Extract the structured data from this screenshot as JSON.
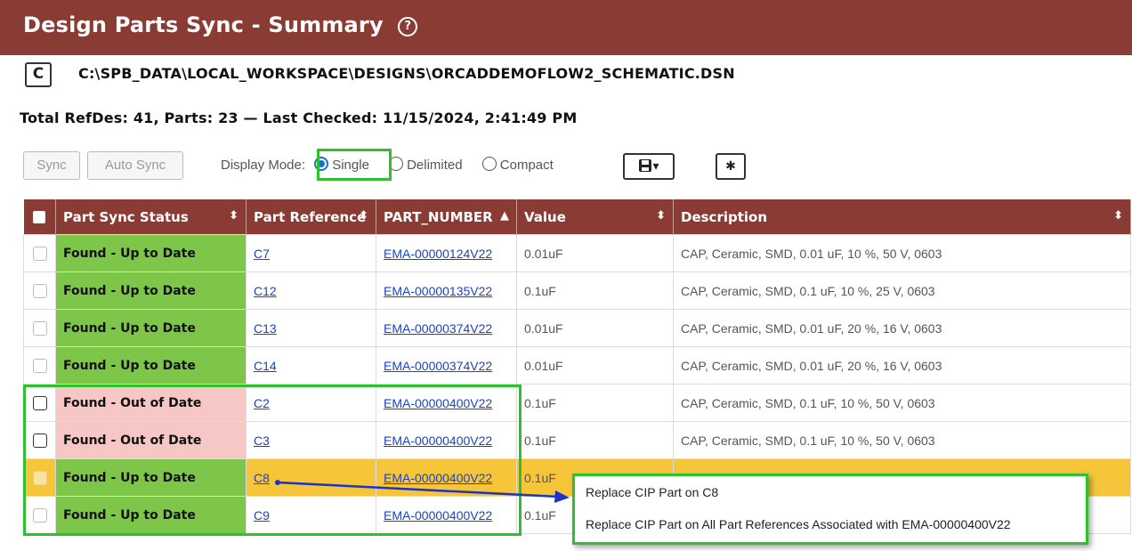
{
  "header": {
    "title": "Design Parts Sync - Summary",
    "help_glyph": "?"
  },
  "refresh": {
    "glyph": "C"
  },
  "file_path": "C:\\SPB_DATA\\LOCAL_WORKSPACE\\DESIGNS\\ORCADDEMOFLOW2_SCHEMATIC.DSN",
  "summary": "Total RefDes: 41, Parts: 23 — Last Checked: 11/15/2024, 2:41:49 PM",
  "toolbar": {
    "sync_label": "Sync",
    "auto_sync_label": "Auto Sync",
    "display_mode_label": "Display Mode:",
    "modes": [
      "Single",
      "Delimited",
      "Compact"
    ],
    "selected_mode": "Single",
    "save_glyph": "▾",
    "settings_glyph": "✱"
  },
  "table": {
    "columns": [
      "Part Sync Status",
      "Part Reference",
      "PART_NUMBER",
      "Value",
      "Description"
    ],
    "rows": [
      {
        "status": "Found - Up to Date",
        "ref": "C7",
        "part": "EMA-00000124V22",
        "value": "0.01uF",
        "desc": "CAP, Ceramic, SMD, 0.01 uF, 10 %, 50 V, 0603"
      },
      {
        "status": "Found - Up to Date",
        "ref": "C12",
        "part": "EMA-00000135V22",
        "value": "0.1uF",
        "desc": "CAP, Ceramic, SMD, 0.1 uF, 10 %, 25 V, 0603"
      },
      {
        "status": "Found - Up to Date",
        "ref": "C13",
        "part": "EMA-00000374V22",
        "value": "0.01uF",
        "desc": "CAP, Ceramic, SMD, 0.01 uF, 20 %, 16 V, 0603"
      },
      {
        "status": "Found - Up to Date",
        "ref": "C14",
        "part": "EMA-00000374V22",
        "value": "0.01uF",
        "desc": "CAP, Ceramic, SMD, 0.01 uF, 20 %, 16 V, 0603"
      },
      {
        "status": "Found - Out of Date",
        "ref": "C2",
        "part": "EMA-00000400V22",
        "value": "0.1uF",
        "desc": "CAP, Ceramic, SMD, 0.1 uF, 10 %, 50 V, 0603"
      },
      {
        "status": "Found - Out of Date",
        "ref": "C3",
        "part": "EMA-00000400V22",
        "value": "0.1uF",
        "desc": "CAP, Ceramic, SMD, 0.1 uF, 10 %, 50 V, 0603"
      },
      {
        "status": "Found - Up to Date",
        "ref": "C8",
        "part": "EMA-00000400V22",
        "value": "0.1uF",
        "desc": ""
      },
      {
        "status": "Found - Up to Date",
        "ref": "C9",
        "part": "EMA-00000400V22",
        "value": "0.1uF",
        "desc": ""
      }
    ]
  },
  "context_menu": {
    "items": [
      "Replace CIP Part on C8",
      "Replace CIP Part on All Part References Associated with EMA-00000400V22"
    ]
  },
  "colors": {
    "header_bg": "#8a3c34",
    "up_to_date": "#7dc64a",
    "out_of_date": "#f6c7c4",
    "row_highlight": "#f7c53a",
    "annotation": "#2fbf2f"
  }
}
